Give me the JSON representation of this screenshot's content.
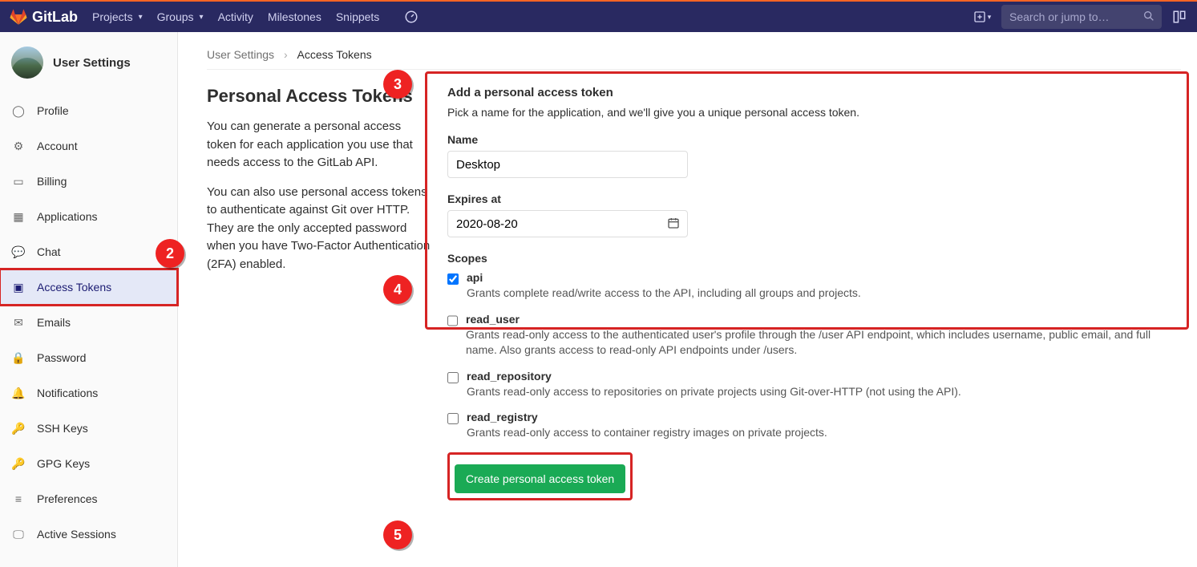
{
  "topnav": {
    "brand": "GitLab",
    "items": [
      "Projects",
      "Groups",
      "Activity",
      "Milestones",
      "Snippets"
    ],
    "search_placeholder": "Search or jump to…"
  },
  "sidebar": {
    "title": "User Settings",
    "items": [
      {
        "icon": "profile",
        "label": "Profile"
      },
      {
        "icon": "account",
        "label": "Account"
      },
      {
        "icon": "billing",
        "label": "Billing"
      },
      {
        "icon": "apps",
        "label": "Applications"
      },
      {
        "icon": "chat",
        "label": "Chat"
      },
      {
        "icon": "token",
        "label": "Access Tokens",
        "active": true,
        "highlight": true
      },
      {
        "icon": "emails",
        "label": "Emails"
      },
      {
        "icon": "password",
        "label": "Password"
      },
      {
        "icon": "notif",
        "label": "Notifications"
      },
      {
        "icon": "ssh",
        "label": "SSH Keys"
      },
      {
        "icon": "gpg",
        "label": "GPG Keys"
      },
      {
        "icon": "prefs",
        "label": "Preferences"
      },
      {
        "icon": "sessions",
        "label": "Active Sessions"
      }
    ]
  },
  "breadcrumbs": {
    "root": "User Settings",
    "current": "Access Tokens"
  },
  "left": {
    "heading": "Personal Access Tokens",
    "p1": "You can generate a personal access token for each application you use that needs access to the GitLab API.",
    "p2": "You can also use personal access tokens to authenticate against Git over HTTP. They are the only accepted password when you have Two-Factor Authentication (2FA) enabled."
  },
  "form": {
    "heading": "Add a personal access token",
    "subtitle": "Pick a name for the application, and we'll give you a unique personal access token.",
    "name_label": "Name",
    "name_value": "Desktop",
    "expires_label": "Expires at",
    "expires_value": "2020-08-20",
    "scopes_label": "Scopes",
    "scopes": [
      {
        "name": "api",
        "checked": true,
        "desc": "Grants complete read/write access to the API, including all groups and projects."
      },
      {
        "name": "read_user",
        "checked": false,
        "desc": "Grants read-only access to the authenticated user's profile through the /user API endpoint, which includes username, public email, and full name. Also grants access to read-only API endpoints under /users."
      },
      {
        "name": "read_repository",
        "checked": false,
        "desc": "Grants read-only access to repositories on private projects using Git-over-HTTP (not using the API)."
      },
      {
        "name": "read_registry",
        "checked": false,
        "desc": "Grants read-only access to container registry images on private projects."
      }
    ],
    "submit_label": "Create personal access token"
  },
  "annotations": {
    "b2": "2",
    "b3": "3",
    "b4": "4",
    "b5": "5"
  }
}
